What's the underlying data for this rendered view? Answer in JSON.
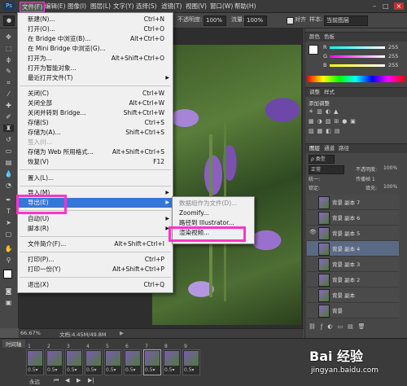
{
  "menubar": {
    "items": [
      "文件(F)",
      "编辑(E)",
      "图像(I)",
      "图层(L)",
      "文字(Y)",
      "选择(S)",
      "滤镜(T)",
      "视图(V)",
      "窗口(W)",
      "帮助(H)"
    ]
  },
  "options": {
    "opacity_label": "不透明度:",
    "opacity_value": "100%",
    "flow_label": "流量:",
    "flow_value": "100%",
    "align_label": "对齐",
    "sample_label": "样本:",
    "sample_value": "当前图层"
  },
  "file_menu": {
    "items": [
      {
        "label": "新建(N)...",
        "shortcut": "Ctrl+N"
      },
      {
        "label": "打开(O)...",
        "shortcut": "Ctrl+O"
      },
      {
        "label": "在 Bridge 中浏览(B)...",
        "shortcut": "Alt+Ctrl+O"
      },
      {
        "label": "在 Mini Bridge 中浏览(G)...",
        "shortcut": ""
      },
      {
        "label": "打开为...",
        "shortcut": "Alt+Shift+Ctrl+O"
      },
      {
        "label": "打开为智能对象...",
        "shortcut": ""
      },
      {
        "label": "最近打开文件(T)",
        "shortcut": ""
      },
      {
        "label": "关闭(C)",
        "shortcut": "Ctrl+W"
      },
      {
        "label": "关闭全部",
        "shortcut": "Alt+Ctrl+W"
      },
      {
        "label": "关闭并转到 Bridge...",
        "shortcut": "Shift+Ctrl+W"
      },
      {
        "label": "存储(S)",
        "shortcut": "Ctrl+S"
      },
      {
        "label": "存储为(A)...",
        "shortcut": "Shift+Ctrl+S"
      },
      {
        "label": "签入(I)...",
        "shortcut": ""
      },
      {
        "label": "存储为 Web 所用格式...",
        "shortcut": "Alt+Shift+Ctrl+S"
      },
      {
        "label": "恢复(V)",
        "shortcut": "F12"
      },
      {
        "label": "置入(L)...",
        "shortcut": ""
      },
      {
        "label": "导入(M)",
        "shortcut": ""
      },
      {
        "label": "导出(E)",
        "shortcut": ""
      },
      {
        "label": "自动(U)",
        "shortcut": ""
      },
      {
        "label": "脚本(R)",
        "shortcut": ""
      },
      {
        "label": "文件简介(F)...",
        "shortcut": "Alt+Shift+Ctrl+I"
      },
      {
        "label": "打印(P)...",
        "shortcut": "Ctrl+P"
      },
      {
        "label": "打印一份(Y)",
        "shortcut": "Alt+Shift+Ctrl+P"
      },
      {
        "label": "退出(X)",
        "shortcut": "Ctrl+Q"
      }
    ]
  },
  "export_submenu": {
    "items": [
      "数据组作为文件(D)...",
      "Zoomify...",
      "路径到 Illustrator...",
      "渲染视频..."
    ]
  },
  "status": {
    "zoom": "66.67%",
    "doc": "文档:4.45M/49.8M"
  },
  "timeline": {
    "tab": "时间轴",
    "frames": [
      {
        "num": "1",
        "time": "0.5▾"
      },
      {
        "num": "2",
        "time": "0.5▾"
      },
      {
        "num": "3",
        "time": "0.5▾"
      },
      {
        "num": "4",
        "time": "0.5▾"
      },
      {
        "num": "5",
        "time": "0.5▾"
      },
      {
        "num": "6",
        "time": "0.5▾"
      },
      {
        "num": "7",
        "time": "0.5▾"
      },
      {
        "num": "8",
        "time": "0.5▾"
      },
      {
        "num": "9",
        "time": "0.5▾"
      }
    ],
    "loop": "永远"
  },
  "panels": {
    "color_tab": "颜色",
    "swatch_tab": "色板",
    "r_label": "R",
    "g_label": "G",
    "b_label": "B",
    "r_value": "255",
    "g_value": "255",
    "b_value": "255",
    "adjust_tab": "调整",
    "style_tab": "样式",
    "adjust_title": "添加调整",
    "layers_tab": "图层",
    "channels_tab": "通道",
    "paths_tab": "路径",
    "kind_label": "ρ 类型",
    "blend_mode": "正常",
    "opacity_label": "不透明度:",
    "opacity_value": "100%",
    "unify_label": "统一:",
    "propagate_label": "传播帧 1",
    "lock_label": "锁定:",
    "fill_label": "填充:",
    "fill_value": "100%",
    "layers": [
      "背景 副本 7",
      "背景 副本 6",
      "背景 副本 5",
      "背景 副本 4",
      "背景 副本 3",
      "背景 副本 2",
      "背景 副本",
      "背景"
    ]
  },
  "watermark": {
    "brand": "Bai 经验",
    "url": "jingyan.baidu.com"
  }
}
